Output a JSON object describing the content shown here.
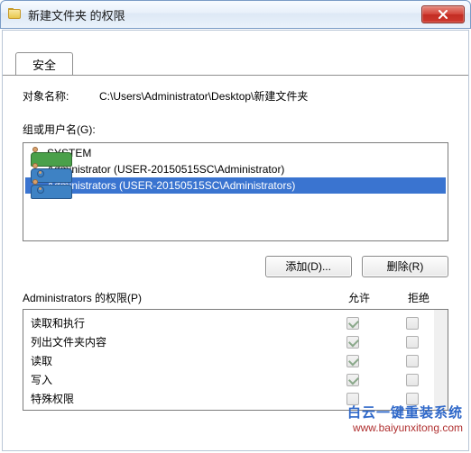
{
  "window": {
    "title": "新建文件夹 的权限"
  },
  "tab": {
    "label": "安全"
  },
  "object": {
    "label": "对象名称:",
    "path": "C:\\Users\\Administrator\\Desktop\\新建文件夹"
  },
  "group": {
    "label": "组或用户名(G):",
    "items": [
      {
        "name": "SYSTEM",
        "iconColor": "green"
      },
      {
        "name": "Administrator (USER-20150515SC\\Administrator)",
        "iconColor": "blue"
      },
      {
        "name": "Administrators (USER-20150515SC\\Administrators)",
        "iconColor": "blue",
        "selected": true
      }
    ]
  },
  "buttons": {
    "add": "添加(D)...",
    "remove": "删除(R)"
  },
  "perm": {
    "title": "Administrators 的权限(P)",
    "col_allow": "允许",
    "col_deny": "拒绝",
    "rows": [
      {
        "label": "读取和执行",
        "allow": true,
        "deny": false,
        "disabled": true
      },
      {
        "label": "列出文件夹内容",
        "allow": true,
        "deny": false,
        "disabled": true
      },
      {
        "label": "读取",
        "allow": true,
        "deny": false,
        "disabled": true
      },
      {
        "label": "写入",
        "allow": true,
        "deny": false,
        "disabled": true
      },
      {
        "label": "特殊权限",
        "allow": false,
        "deny": false,
        "disabled": true
      }
    ]
  },
  "watermark": {
    "title": "白云一键重装系统",
    "url": "www.baiyunxitong.com"
  }
}
